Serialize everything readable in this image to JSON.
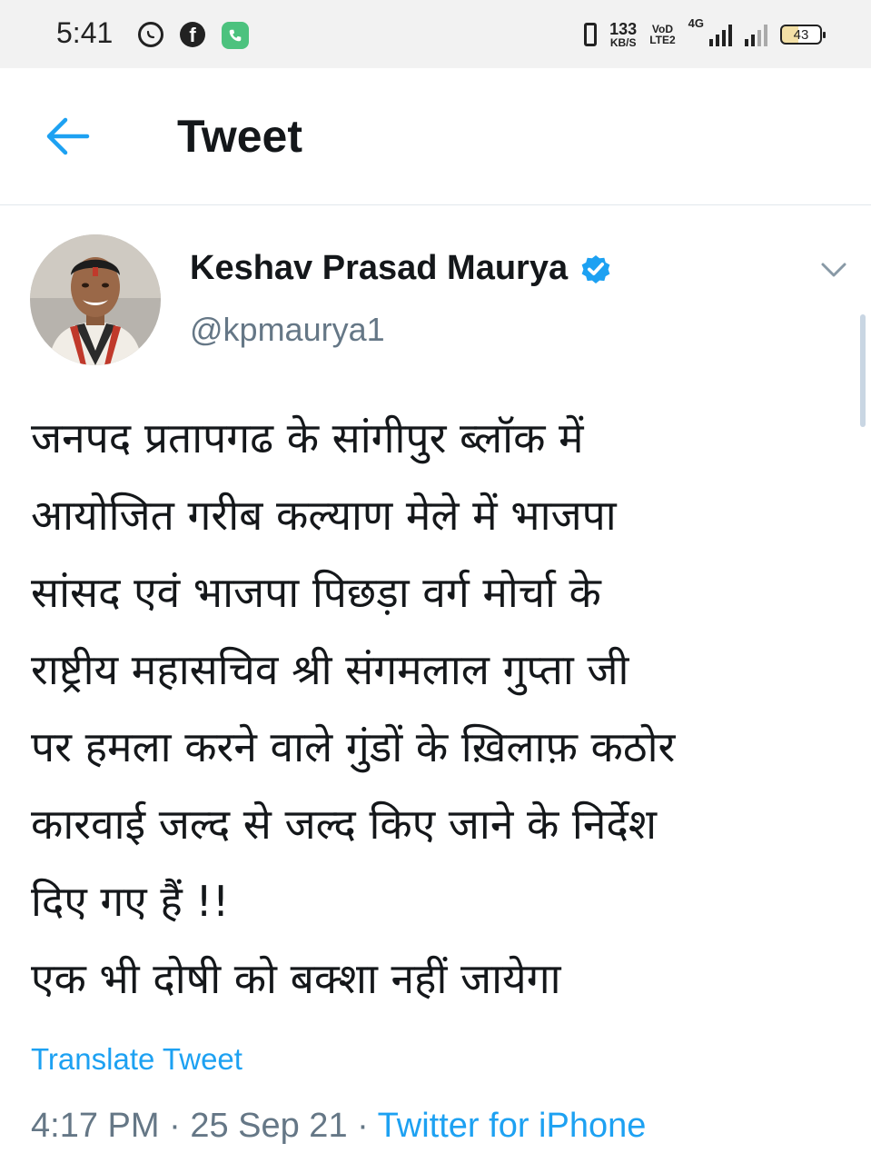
{
  "status_bar": {
    "time": "5:41",
    "net_speed_value": "133",
    "net_speed_unit": "KB/S",
    "volte_top": "VoD",
    "volte_bottom": "LTE2",
    "network_type": "4G",
    "battery": "43",
    "icons": [
      "whatsapp-icon",
      "facebook-icon",
      "phone-app-icon",
      "vibrate-icon",
      "signal-icon",
      "battery-icon"
    ]
  },
  "header": {
    "title": "Tweet"
  },
  "tweet": {
    "author_name": "Keshav Prasad Maurya",
    "handle": "@kpmaurya1",
    "verified": true,
    "lines": [
      "जनपद प्रतापगढ के सांगीपुर ब्लॉक में",
      "आयोजित गरीब कल्याण मेले में भाजपा",
      "सांसद एवं भाजपा पिछड़ा वर्ग मोर्चा के",
      "राष्ट्रीय महासचिव श्री संगमलाल गुप्ता जी",
      "पर हमला करने वाले गुंडों के ख़िलाफ़ कठोर",
      "कारवाई जल्द से जल्द किए जाने के निर्देश",
      "दिए गए हैं !!",
      "एक भी दोषी को बक्शा नहीं जायेगा"
    ],
    "translate_label": "Translate Tweet",
    "time": "4:17 PM",
    "separator": " · ",
    "date": "25 Sep 21",
    "source": "Twitter for iPhone"
  },
  "colors": {
    "accent": "#1da1f2",
    "text": "#14171a",
    "secondary": "#657786",
    "status_bar_bg": "#f2f2f2"
  }
}
